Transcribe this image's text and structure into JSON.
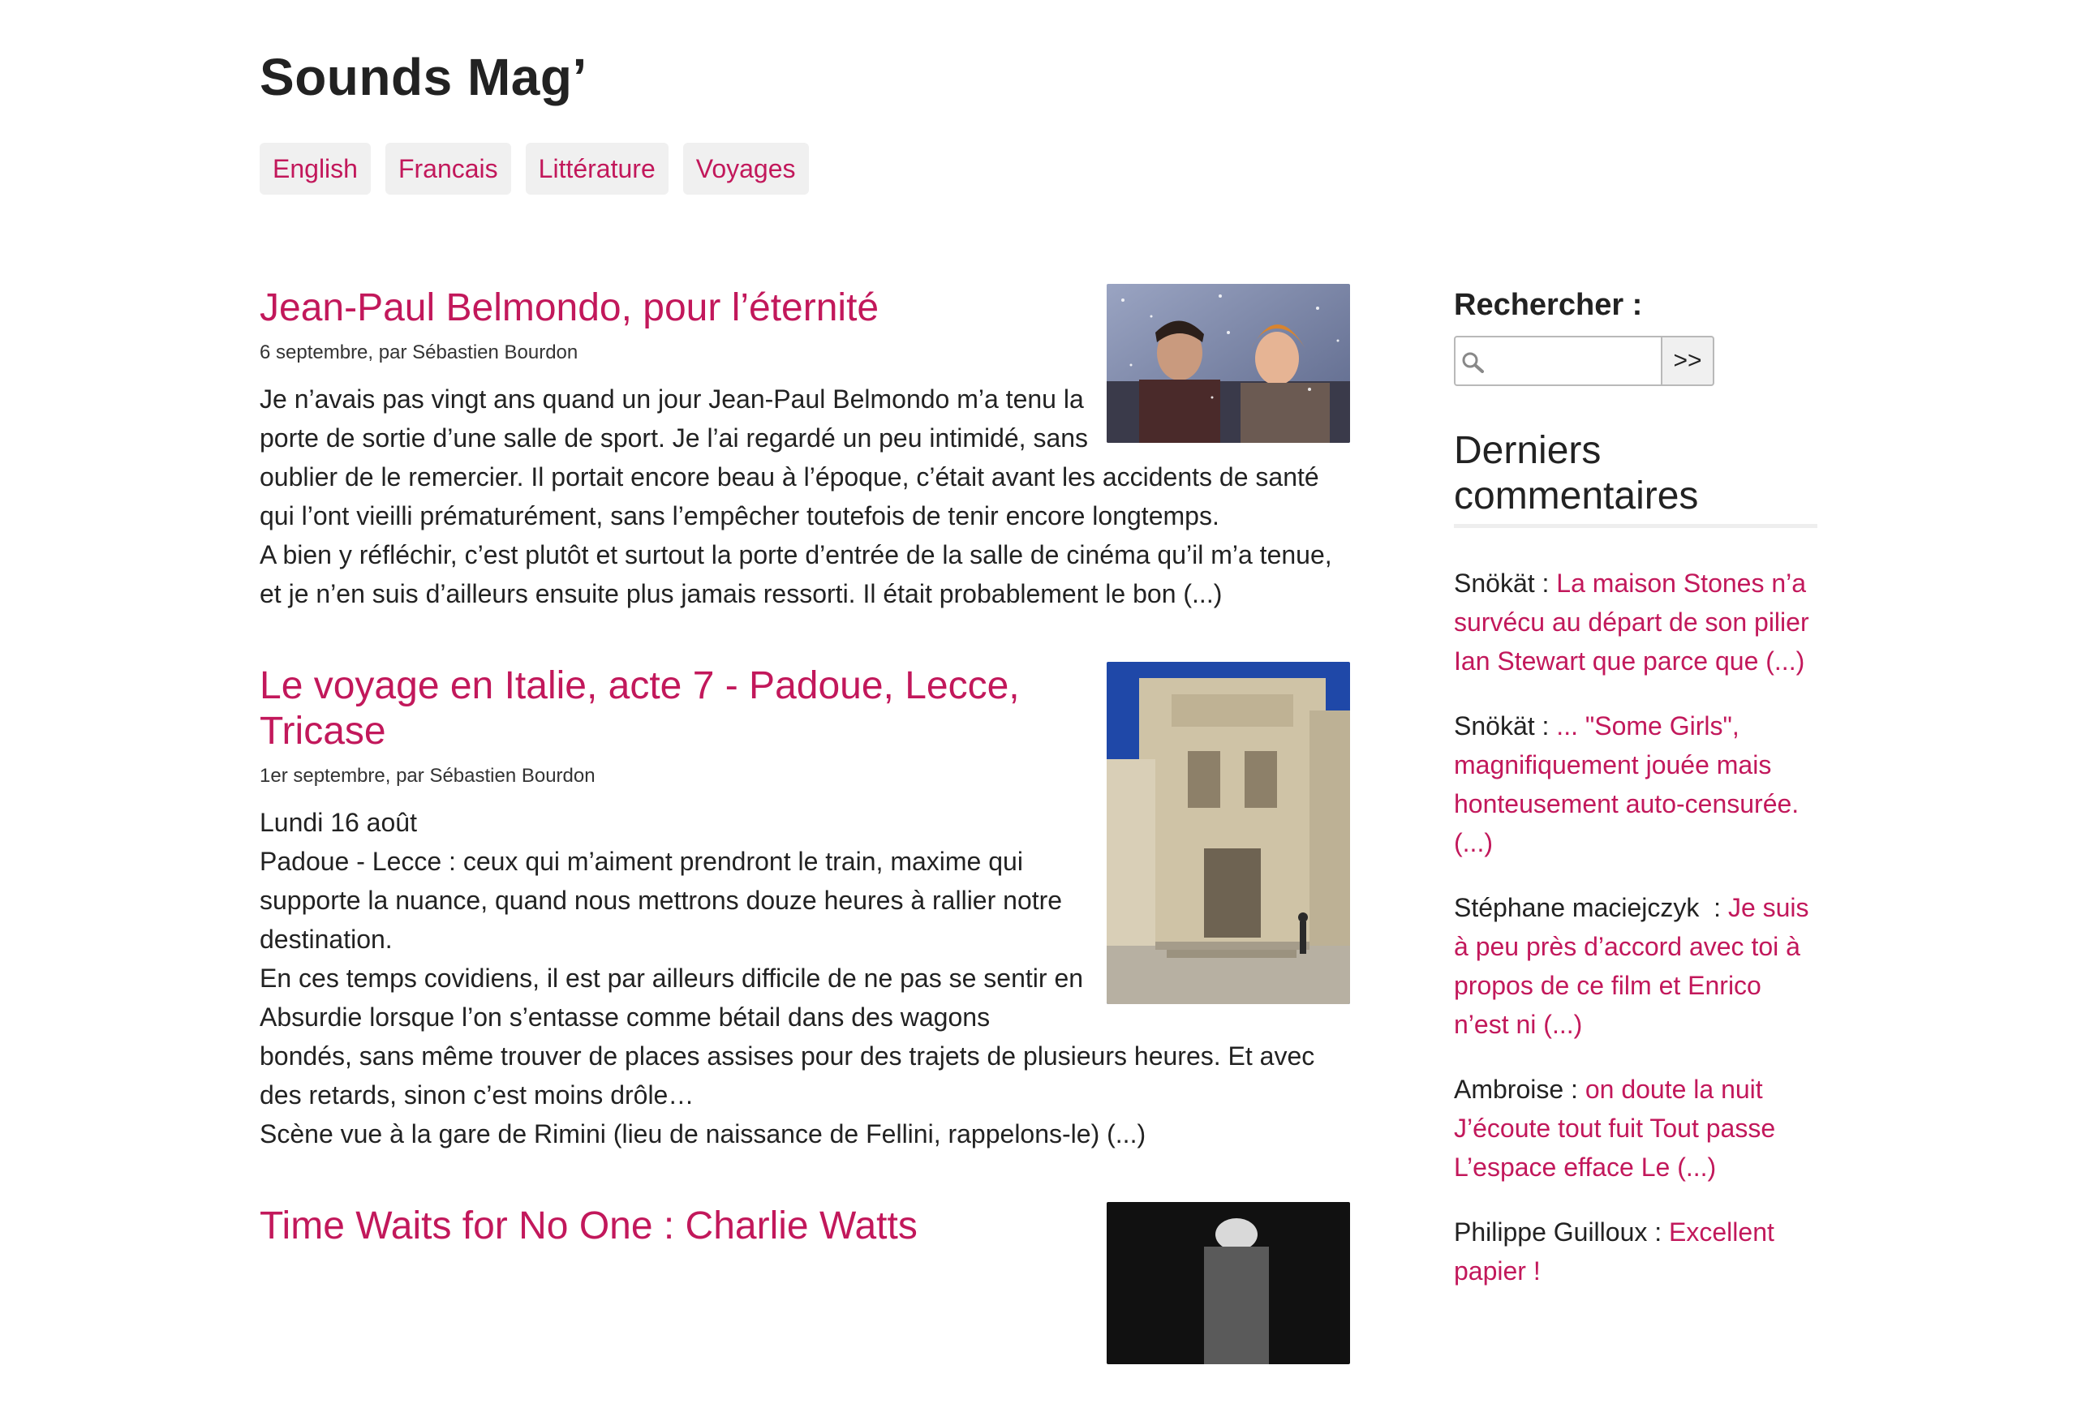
{
  "site": {
    "title": "Sounds Mag’"
  },
  "nav": [
    {
      "label": "English"
    },
    {
      "label": "Francais"
    },
    {
      "label": "Littérature"
    },
    {
      "label": "Voyages"
    }
  ],
  "articles": [
    {
      "title": "Jean-Paul Belmondo, pour l’éternité",
      "meta": "6 septembre, par Sébastien Bourdon",
      "paragraphs": [
        "Je n’avais pas vingt ans quand un jour Jean-Paul Belmondo m’a tenu la porte de sortie d’une salle de sport. Je l’ai regardé un peu intimidé, sans oublier de le remercier. Il portait encore beau à l’époque, c’était avant les accidents de santé qui l’ont vieilli prématurément, sans l’empêcher toutefois de tenir encore longtemps.",
        "A bien y réfléchir, c’est plutôt et surtout la porte d’entrée de la salle de cinéma qu’il m’a tenue, et je n’en suis d’ailleurs ensuite plus jamais ressorti. Il était probablement le bon (...)"
      ]
    },
    {
      "title": "Le voyage en Italie, acte 7 - Padoue, Lecce, Tricase",
      "meta": "1er septembre, par Sébastien Bourdon",
      "paragraphs": [
        "Lundi 16 août",
        "Padoue - Lecce : ceux qui m’aiment prendront le train, maxime qui supporte la nuance, quand nous mettrons douze heures à rallier notre destination.",
        "En ces temps covidiens, il est par ailleurs difficile de ne pas se sentir en Absurdie lorsque l’on s’entasse comme bétail dans des wagons bondés, sans même trouver de places assises pour des trajets de plusieurs heures. Et avec des retards, sinon c’est moins drôle…",
        "Scène vue à la gare de Rimini (lieu de naissance de Fellini, rappelons-le) (...)"
      ]
    },
    {
      "title": "Time Waits for No One : Charlie Watts",
      "meta": "",
      "paragraphs": []
    }
  ],
  "sidebar": {
    "search_label": "Rechercher :",
    "search_value": "",
    "search_submit": ">>",
    "comments_title": "Derniers commentaires",
    "comments": [
      {
        "author": "Snökät : ",
        "text": "La maison Stones n’a survécu au départ de son pilier Ian Stewart que parce que (...)"
      },
      {
        "author": "Snökät : ",
        "text": "... \"Some Girls\", magnifiquement jouée mais honteusement auto-censurée. (...)"
      },
      {
        "author": "Stéphane maciejczyk  : ",
        "text": "Je suis à peu près d’accord avec toi à propos de ce film et Enrico n’est ni (...)"
      },
      {
        "author": "Ambroise : ",
        "text": "on doute la nuit J’écoute tout fuit Tout passe L’espace efface Le (...)"
      },
      {
        "author": "Philippe Guilloux : ",
        "text": "Excellent papier !"
      }
    ]
  },
  "colors": {
    "link": "#c2185b",
    "text": "#222222",
    "nav_bg": "#f0f0f0"
  }
}
